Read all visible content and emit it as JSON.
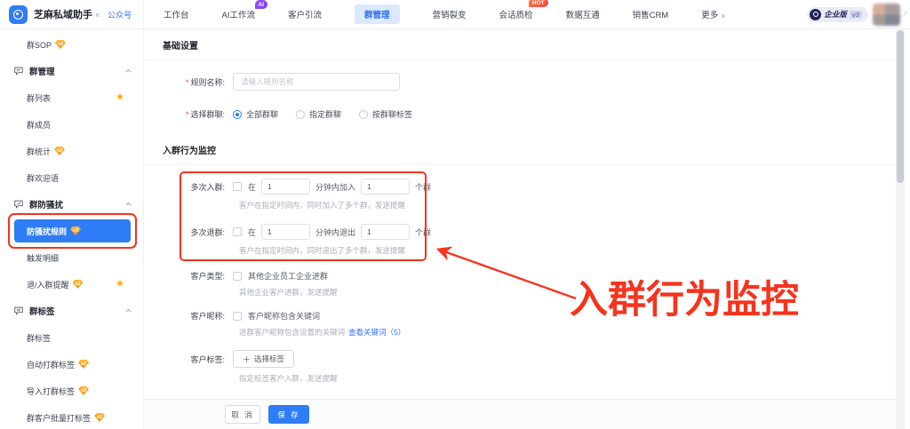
{
  "colors": {
    "accent": "#2e7cf6",
    "annotation_red": "#f5341e",
    "badge_orange": "#f7941f"
  },
  "topbar": {
    "logo": "芝麻私域助手",
    "account_type": "公众号",
    "nav": [
      {
        "label": "工作台"
      },
      {
        "label": "AI工作流",
        "badge": "AI"
      },
      {
        "label": "客户引流"
      },
      {
        "label": "群管理",
        "active": true
      },
      {
        "label": "营销裂变"
      },
      {
        "label": "会话质检",
        "badge": "HOT"
      },
      {
        "label": "数据互通"
      },
      {
        "label": "销售CRM"
      },
      {
        "label": "更多"
      }
    ],
    "enterprise": {
      "label": "企业版",
      "version": "v3"
    }
  },
  "sidebar": {
    "items": [
      {
        "label": "群SOP",
        "badge": "v2"
      },
      {
        "label": "群管理",
        "type": "section"
      },
      {
        "label": "群列表",
        "starred": true
      },
      {
        "label": "群成员"
      },
      {
        "label": "群统计",
        "badge": "v2"
      },
      {
        "label": "群欢迎语"
      },
      {
        "label": "群防骚扰",
        "type": "section"
      },
      {
        "label": "防骚扰规则",
        "badge": "v2",
        "active": true
      },
      {
        "label": "触发明细"
      },
      {
        "label": "退/入群提醒",
        "badge": "v2",
        "starred": true
      },
      {
        "label": "群标签",
        "type": "section"
      },
      {
        "label": "群标签"
      },
      {
        "label": "自动打群标签",
        "badge": "v2"
      },
      {
        "label": "导入打群标签",
        "badge": "v2"
      },
      {
        "label": "群客户批量打标签",
        "badge": "v2"
      }
    ]
  },
  "main": {
    "basic": {
      "title": "基础设置",
      "rule_name": {
        "required": "*",
        "label": "规则名称:",
        "placeholder": "请输入规则名称"
      },
      "group_select": {
        "required": "*",
        "label": "选择群聊:",
        "options": [
          {
            "label": "全部群聊",
            "selected": true
          },
          {
            "label": "指定群聊"
          },
          {
            "label": "按群聊标签"
          }
        ]
      }
    },
    "monitor": {
      "title": "入群行为监控",
      "multi_join": {
        "label": "多次入群:",
        "pre": "在",
        "minutes": "1",
        "mid": "分钟内加入",
        "count": "1",
        "suf": "个群",
        "help": "客户在指定时间内，同时加入了多个群，发送提醒"
      },
      "multi_quit": {
        "label": "多次退群:",
        "pre": "在",
        "minutes": "1",
        "mid": "分钟内退出",
        "count": "1",
        "suf": "个群",
        "help": "客户在指定时间内，同时退出了多个群，发送提醒"
      },
      "customer_type": {
        "label": "客户类型:",
        "option": "其他企业员工企业进群",
        "help": "其他企业客户进群，发送提醒"
      },
      "customer_nickname": {
        "label": "客户昵称:",
        "option": "客户昵称包含关键词",
        "help": "进群客户昵称包含设置的关键词",
        "link": "查看关键词（5）"
      },
      "customer_tag": {
        "label": "客户标签:",
        "button": "选择标签",
        "help": "指定标签客户入群，发送提醒"
      }
    }
  },
  "footer": {
    "cancel": "取 消",
    "save": "保 存"
  },
  "annotation": {
    "text": "入群行为监控"
  }
}
